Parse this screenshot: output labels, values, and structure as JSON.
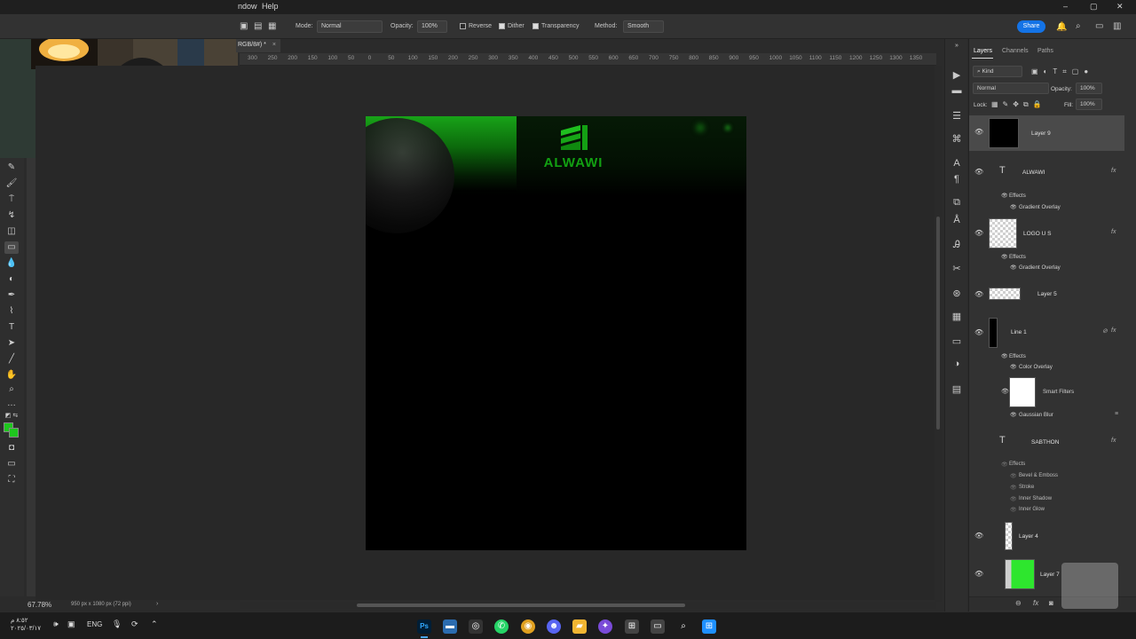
{
  "menubar": {
    "items": [
      "ndow",
      "Help"
    ]
  },
  "options": {
    "mode_label": "Mode:",
    "mode_value": "Normal",
    "opacity_label": "Opacity:",
    "opacity_value": "100%",
    "reverse": "Reverse",
    "dither": "Dither",
    "transparency": "Transparency",
    "method_label": "Method:",
    "method_value": "Smooth",
    "share": "Share"
  },
  "document": {
    "tab_label": "RGB/8#) *",
    "zoom": "67.78%",
    "doc_info": "950 px x 1080 px (72 ppi)"
  },
  "ruler": {
    "ticks": [
      "300",
      "250",
      "200",
      "150",
      "100",
      "50",
      "0",
      "50",
      "100",
      "150",
      "200",
      "250",
      "300",
      "350",
      "400",
      "450",
      "500",
      "550",
      "600",
      "650",
      "700",
      "750",
      "800",
      "850",
      "900",
      "950",
      "1000",
      "1050",
      "1100",
      "1150",
      "1200",
      "1250",
      "1300",
      "1350"
    ]
  },
  "canvas": {
    "logo_text": "ALWAWI"
  },
  "panel": {
    "tabs": [
      "Layers",
      "Channels",
      "Paths"
    ],
    "filter_kind": "Kind",
    "blend_mode": "Normal",
    "opacity_label": "Opacity:",
    "opacity_value": "100%",
    "lock_label": "Lock:",
    "fill_label": "Fill:",
    "fill_value": "100%",
    "layers": {
      "layer9": "Layer 9",
      "alwawi": "ALWAWI",
      "alwawi_effects": "Effects",
      "alwawi_grad": "Gradient Overlay",
      "logo": "LOGO U S",
      "logo_effects": "Effects",
      "logo_grad": "Gradient Overlay",
      "layer5": "Layer 5",
      "line1": "Line 1",
      "line1_effects": "Effects",
      "line1_color": "Color Overlay",
      "smart_filters": "Smart Filters",
      "gaussian": "Gaussian Blur",
      "sabthon": "SABTHON",
      "sabthon_effects": "Effects",
      "bevel": "Bevel & Emboss",
      "stroke": "Stroke",
      "inner_shadow": "Inner Shadow",
      "inner_glow": "Inner Glow",
      "layer4": "Layer 4",
      "layer7": "Layer 7"
    }
  },
  "taskbar": {
    "lang": "ENG",
    "date": "٢٠٢٥/٠٣/١٧",
    "time": "٨:٥٢ م"
  },
  "colors": {
    "foreground": "#1ec71e",
    "accent": "#1473e6"
  }
}
